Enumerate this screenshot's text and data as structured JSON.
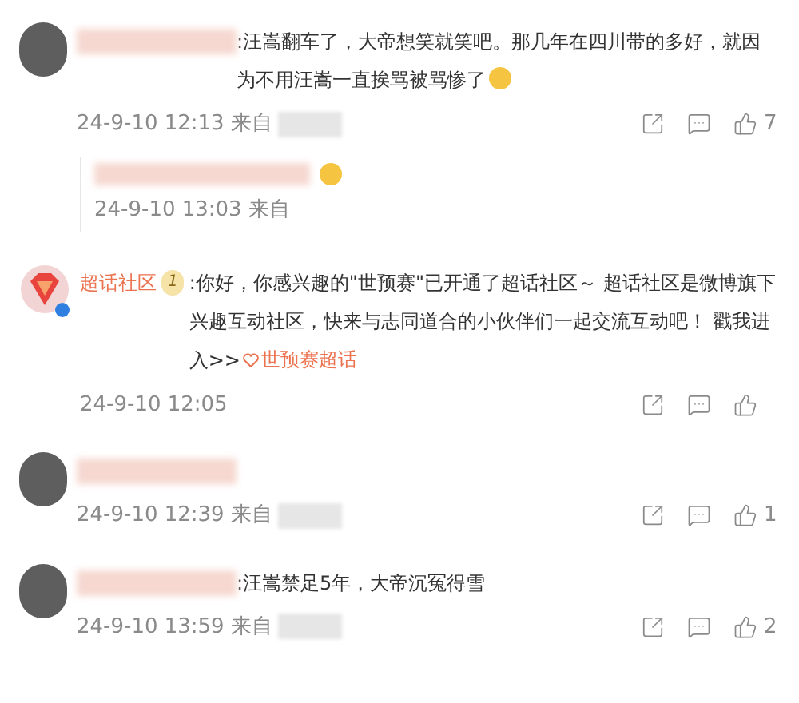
{
  "comments": [
    {
      "kind": "user",
      "text": ":汪嵩翻车了，大帝想笑就笑吧。那几年在四川带的多好，就因为不用汪嵩一直挨骂被骂惨了",
      "emoji": true,
      "date": "24-9-10 12:13",
      "source": "来自",
      "likes": "7",
      "reply": {
        "emoji": true,
        "date": "24-9-10 13:03",
        "source": "来自"
      }
    },
    {
      "kind": "supertopic",
      "name": "超话社区",
      "badge": "1",
      "text": ":你好，你感兴趣的\"世预赛\"已开通了超话社区～ 超话社区是微博旗下兴趣互动社区，快来与志同道合的小伙伴们一起交流互动吧！ 戳我进入>>",
      "link": "世预赛超话",
      "date": "24-9-10 12:05"
    },
    {
      "kind": "user",
      "date": "24-9-10 12:39",
      "source": "来自",
      "likes": "1"
    },
    {
      "kind": "user",
      "text": ":汪嵩禁足5年，大帝沉冤得雪",
      "emoji": false,
      "date": "24-9-10 13:59",
      "source": "来自",
      "likes": "2"
    }
  ]
}
